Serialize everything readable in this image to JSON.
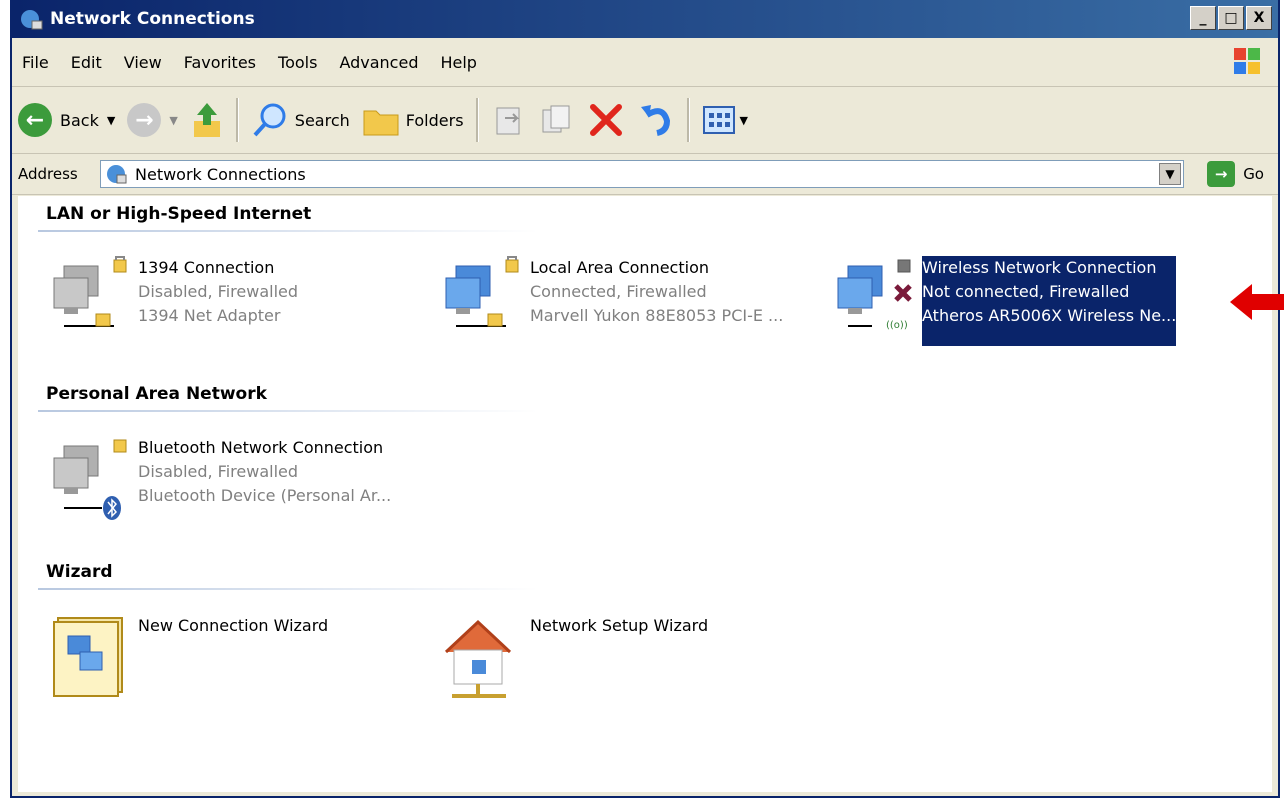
{
  "window": {
    "title": "Network Connections",
    "buttons": [
      "_",
      "□",
      "X"
    ]
  },
  "menu": [
    "File",
    "Edit",
    "View",
    "Favorites",
    "Tools",
    "Advanced",
    "Help"
  ],
  "toolbar": {
    "back": "Back",
    "search": "Search",
    "folders": "Folders"
  },
  "address": {
    "label": "Address",
    "value": "Network Connections",
    "go": "Go"
  },
  "groups": [
    {
      "header": "LAN or High-Speed Internet",
      "items": [
        {
          "name": "1394 Connection",
          "status": "Disabled, Firewalled",
          "device": "1394 Net Adapter"
        },
        {
          "name": "Local Area Connection",
          "status": "Connected, Firewalled",
          "device": "Marvell Yukon 88E8053 PCI-E ..."
        },
        {
          "name": "Wireless Network Connection",
          "status": "Not connected, Firewalled",
          "device": "Atheros AR5006X Wireless Ne..."
        }
      ]
    },
    {
      "header": "Personal Area Network",
      "items": [
        {
          "name": "Bluetooth Network Connection",
          "status": "Disabled, Firewalled",
          "device": "Bluetooth Device (Personal Ar..."
        }
      ]
    },
    {
      "header": "Wizard",
      "items": [
        {
          "name": "New Connection Wizard"
        },
        {
          "name": "Network Setup Wizard"
        }
      ]
    }
  ],
  "colors": {
    "titlebar": "#0a246a",
    "selection": "#0a246a",
    "annotation_arrow": "#e00000"
  },
  "icons": [
    "network-connections-icon",
    "back-icon",
    "forward-icon",
    "up-folder-icon",
    "search-icon",
    "folders-icon",
    "move-to-icon",
    "copy-to-icon",
    "delete-icon",
    "undo-icon",
    "views-icon",
    "windows-logo-icon",
    "go-arrow-icon",
    "computer-lock-icon",
    "computer-lan-icon",
    "wireless-x-icon",
    "bluetooth-icon",
    "wizard-book-icon",
    "house-network-icon",
    "red-arrow-icon"
  ]
}
